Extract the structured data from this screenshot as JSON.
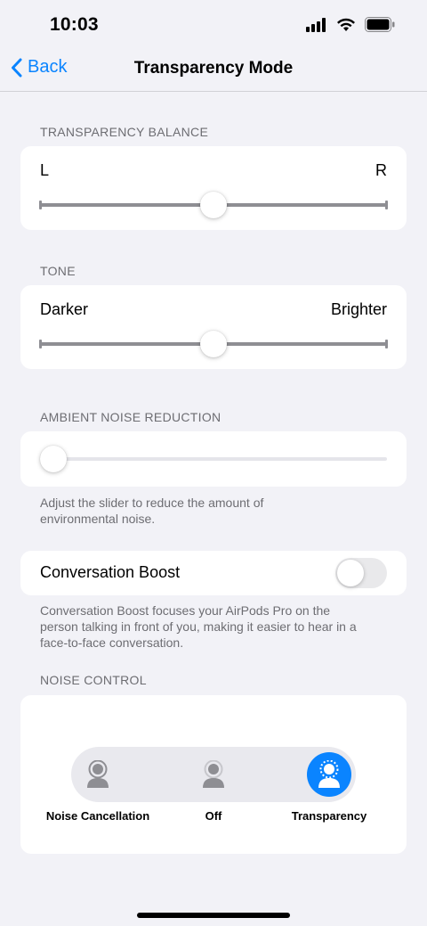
{
  "status_bar": {
    "time": "10:03"
  },
  "nav": {
    "back_label": "Back",
    "title": "Transparency Mode"
  },
  "balance": {
    "label": "TRANSPARENCY BALANCE",
    "left": "L",
    "right": "R",
    "value": 0.5
  },
  "tone": {
    "label": "TONE",
    "left": "Darker",
    "right": "Brighter",
    "value": 0.5
  },
  "ambient": {
    "label": "AMBIENT NOISE REDUCTION",
    "value": 0.0,
    "footnote_line1": "Adjust the slider to reduce the amount of",
    "footnote_line2": "environmental noise."
  },
  "conversation_boost": {
    "label": "Conversation Boost",
    "enabled": false,
    "footnote_line1": "Conversation Boost focuses your AirPods Pro on the",
    "footnote_line2": "person talking in front of you, making it easier to hear in a",
    "footnote_line3": "face-to-face conversation."
  },
  "noise_control": {
    "label": "NOISE CONTROL",
    "modes": [
      {
        "label": "Noise Cancellation",
        "icon": "noise-cancellation-icon"
      },
      {
        "label": "Off",
        "icon": "off-mode-icon"
      },
      {
        "label": "Transparency",
        "icon": "transparency-icon"
      }
    ],
    "selected": "Transparency"
  },
  "colors": {
    "accent": "#0a84ff",
    "background": "#f2f2f7",
    "secondary_text": "#6d6d72"
  }
}
